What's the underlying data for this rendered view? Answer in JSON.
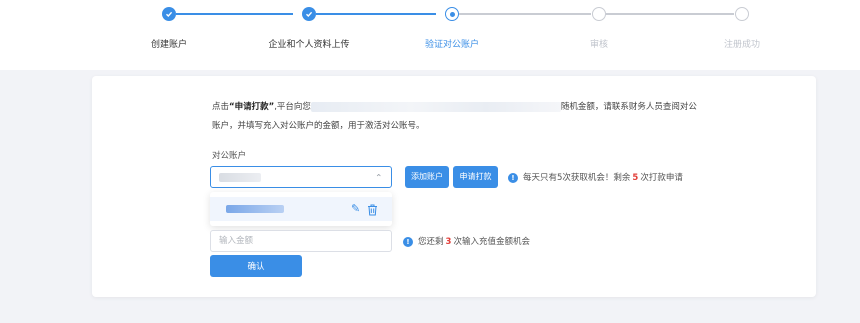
{
  "stepper": {
    "steps": [
      {
        "label": "创建账户",
        "status": "done"
      },
      {
        "label": "企业和个人资料上传",
        "status": "done"
      },
      {
        "label": "验证对公账户",
        "status": "active"
      },
      {
        "label": "审核",
        "status": "pending"
      },
      {
        "label": "注册成功",
        "status": "pending"
      }
    ]
  },
  "info": {
    "prefix": "点击",
    "bold": "“申请打款”",
    "part1": ",平台向您",
    "part2": "随机金额，请联系财务人员查阅对公",
    "line2": "账户，并填写充入对公账户的金额，用于激活对公账号。"
  },
  "account": {
    "label": "对公账户",
    "add_button": "添加账户",
    "apply_button": "申请打款",
    "hint_prefix": "每天只有5次获取机会！剩余",
    "hint_count": "5",
    "hint_suffix": "次打款申请"
  },
  "amount": {
    "placeholder": "输入金额",
    "hint_prefix": "您还剩",
    "hint_count": "3",
    "hint_suffix": "次输入充值金额机会"
  },
  "confirm_button": "确认",
  "colors": {
    "primary": "#3a8ee6",
    "pending": "#c9ccd3",
    "highlight": "#e2403b",
    "background": "#f2f3f7"
  }
}
